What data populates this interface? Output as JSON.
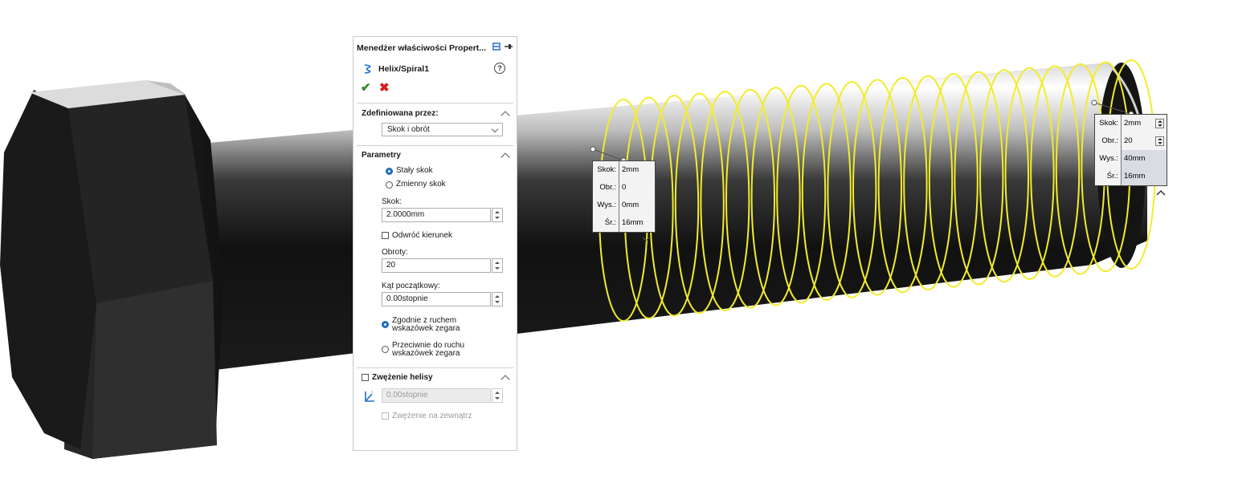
{
  "property_manager": {
    "title": "Menedżer właściwości Propert...",
    "feature_name": "Helix/Spiral1",
    "defined_by": {
      "header": "Zdefiniowana przez:",
      "selected": "Skok i obrót"
    },
    "parameters": {
      "header": "Parametry",
      "constant_pitch": "Stały skok",
      "variable_pitch": "Zmienny skok",
      "pitch_label": "Skok:",
      "pitch_value": "2.0000mm",
      "reverse_direction": "Odwróć kierunek",
      "revolutions_label": "Obroty:",
      "revolutions_value": "20",
      "start_angle_label": "Kąt początkowy:",
      "start_angle_value": "0.00stopnie",
      "clockwise_line1": "Zgodnie z ruchem",
      "clockwise_line2": "wskazówek zegara",
      "counterclockwise_line1": "Przeciwnie do ruchu",
      "counterclockwise_line2": "wskazówek zegara"
    },
    "taper": {
      "header": "Zwężenie helisy",
      "angle_value": "0.00stopnie",
      "taper_outward": "Zwężenie na zewnątrz"
    }
  },
  "callout_start": {
    "rows": [
      {
        "label": "Skok:",
        "value": "2mm"
      },
      {
        "label": "Obr.:",
        "value": "0"
      },
      {
        "label": "Wys.:",
        "value": "0mm"
      },
      {
        "label": "Śr.:",
        "value": "16mm"
      }
    ]
  },
  "callout_end": {
    "rows": [
      {
        "label": "Skok:",
        "value": "2mm"
      },
      {
        "label": "Obr.:",
        "value": "20"
      },
      {
        "label": "Wys.:",
        "value": "40mm"
      },
      {
        "label": "Śr.:",
        "value": "16mm"
      }
    ]
  },
  "colors": {
    "helix": "#f2ec2c",
    "radio_selected": "#1f6bc8",
    "ok": "#2e8b2e",
    "cancel": "#d42020"
  }
}
